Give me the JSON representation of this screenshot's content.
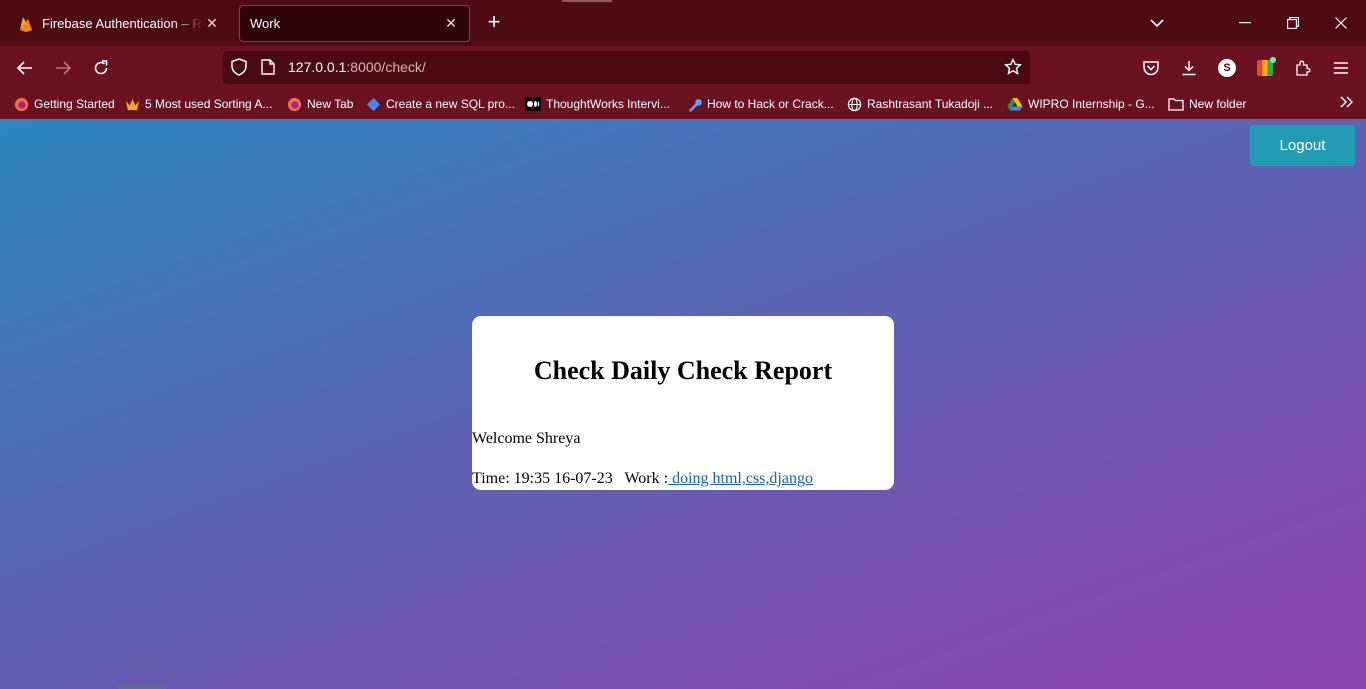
{
  "browser": {
    "tabs": [
      {
        "title": "Firebase Authentication – Realtim",
        "icon": "firebase-icon"
      },
      {
        "title": "Work",
        "icon": "none"
      }
    ],
    "url_host": "127.0.0.1",
    "url_path": ":8000/check/",
    "profile_initial": "S",
    "bookmarks": [
      {
        "label": "Getting Started",
        "icon": "firefox-icon"
      },
      {
        "label": "5 Most used Sorting A...",
        "icon": "crown-icon"
      },
      {
        "label": "New Tab",
        "icon": "firefox-icon"
      },
      {
        "label": "Create a new SQL pro...",
        "icon": "diamond-icon"
      },
      {
        "label": "ThoughtWorks Intervi...",
        "icon": "medium-icon"
      },
      {
        "label": "How to Hack or Crack...",
        "icon": "wrench-icon"
      },
      {
        "label": "Rashtrasant Tukadoji ...",
        "icon": "globe-icon"
      },
      {
        "label": "WIPRO Internship - G...",
        "icon": "drive-icon"
      },
      {
        "label": "New folder",
        "icon": "folder-icon"
      }
    ]
  },
  "page": {
    "logout_label": "Logout",
    "heading": "Check Daily Check Report",
    "welcome": "Welcome Shreya",
    "entry_time": "Time: 19:35 16-07-23   Work :",
    "entry_work_link": " doing html,css,django"
  },
  "colors": {
    "tab_strip": "#4f0b12",
    "toolbar": "#6b1220",
    "logout_button": "#219cb3",
    "link": "#1a5fb4"
  }
}
